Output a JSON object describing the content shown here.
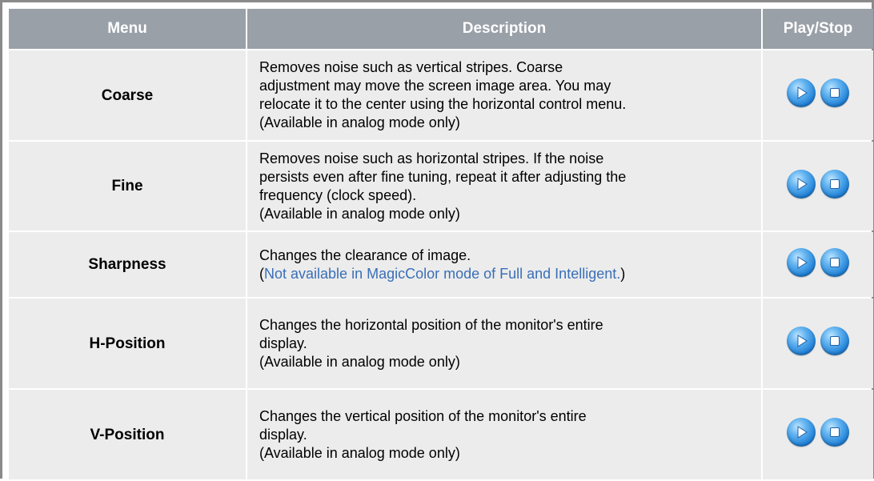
{
  "table": {
    "headers": {
      "menu": "Menu",
      "description": "Description",
      "play_stop": "Play/Stop"
    },
    "rows": [
      {
        "menu": "Coarse",
        "lines": [
          "Removes noise such as vertical stripes. Coarse",
          "adjustment may move the screen image area. You may",
          "relocate it to the center using the horizontal control menu.",
          "(Available in analog mode only)"
        ]
      },
      {
        "menu": "Fine",
        "lines": [
          "Removes noise such as horizontal stripes. If the noise",
          "persists even after fine tuning, repeat it after adjusting the",
          "frequency (clock speed).",
          "(Available in analog mode only)"
        ]
      },
      {
        "menu": "Sharpness",
        "line1": "Changes the clearance of image.",
        "note_open": "(",
        "note": "Not available in MagicColor mode of Full and Intelligent.",
        "note_close": ")"
      },
      {
        "menu": "H-Position",
        "lines": [
          "Changes the horizontal position of the monitor's entire",
          "display.",
          "(Available in analog mode only)"
        ]
      },
      {
        "menu": "V-Position",
        "lines": [
          "Changes the vertical position of the monitor's entire",
          "display.",
          "(Available in analog mode only)"
        ]
      }
    ]
  },
  "icons": {
    "play": "play-icon",
    "stop": "stop-icon"
  },
  "colors": {
    "header_bg": "#9aa0a8",
    "cell_bg": "#ececec",
    "note_blue": "#3a6fb7",
    "button_blue": "#2383d8"
  }
}
